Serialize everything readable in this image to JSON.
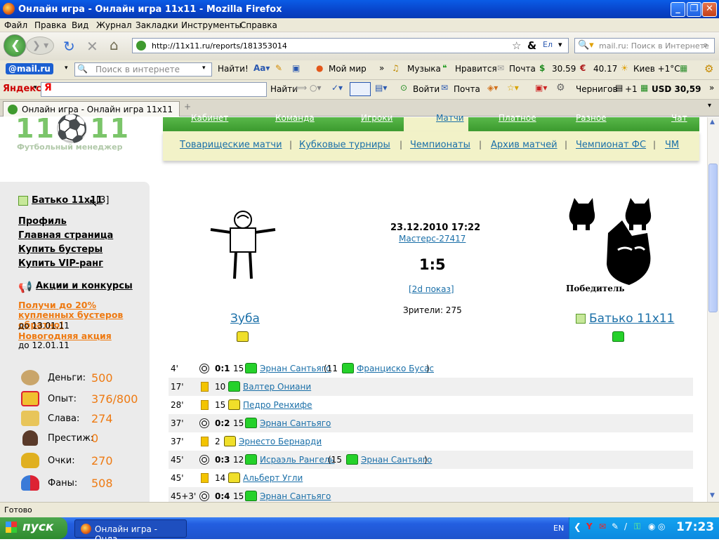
{
  "window": {
    "title": "Онлайн игра - Онлайн игра 11x11 - Mozilla Firefox"
  },
  "menu": [
    "Файл",
    "Правка",
    "Вид",
    "Журнал",
    "Закладки",
    "Инструменты",
    "Справка"
  ],
  "nav": {
    "url": "http://11x11.ru/reports/181353014",
    "search_placeholder": "mail.ru: Поиск в Интернете"
  },
  "mailru_toolbar": {
    "brand": "@mail.ru",
    "search_placeholder": "Поиск в интернете",
    "find_label": "Найти!",
    "mymir": "Мой мир",
    "music": "Музыка",
    "likes": "Нравится",
    "mail": "Почта",
    "usd": "30.59",
    "eur": "40.17",
    "weather": "Киев +1°С"
  },
  "yandex_toolbar": {
    "brand": "Яндекс",
    "find_label": "Найти",
    "login": "Войти",
    "mail": "Почта",
    "city": "Чернигов",
    "points": "+1",
    "usd": "USD 30,59"
  },
  "tab": {
    "title": "Онлайн игра - Онлайн игра 11x11",
    "new_tab": "+"
  },
  "site": {
    "logo_tagline": "Футбольный менеджер",
    "top_nav": [
      "Кабинет",
      "Команда",
      "Игроки",
      "Матчи",
      "Платное",
      "Разное",
      "Чат"
    ],
    "sub_nav": [
      "Товарищеские матчи",
      "Кубковые турниры",
      "Чемпионаты",
      "Архив матчей",
      "Чемпионат ФС",
      "ЧМ"
    ]
  },
  "sidebar": {
    "user": "Батько 11x11",
    "user_level": "[3]",
    "links": [
      "Профиль",
      "Главная страница",
      "Купить бустеры",
      "Купить VIP-ранг"
    ],
    "promo_title": "Акции и конкурсы",
    "promo1": "Получи до 20% купленных бустеров обратно!",
    "promo1_until": "до 13.01.11",
    "promo2": "Новогодняя акция",
    "promo2_until": "до 12.01.11",
    "stats": [
      {
        "label": "Деньги:",
        "value": "500"
      },
      {
        "label": "Опыт:",
        "value": "376/800"
      },
      {
        "label": "Слава:",
        "value": "274"
      },
      {
        "label": "Престиж:",
        "value": "0"
      },
      {
        "label": "Очки:",
        "value": "270"
      },
      {
        "label": "Фаны:",
        "value": "508"
      }
    ]
  },
  "match": {
    "datetime": "23.12.2010 17:22",
    "tournament": "Мастерс-27417",
    "score": "1:5",
    "show2d": "[2d показ]",
    "spectators": "Зрители: 275",
    "home_team": "Зуба",
    "away_team": "Батько 11x11",
    "winner_label": "Победитель"
  },
  "events": [
    {
      "min": "4'",
      "type": "goal",
      "score": "0:1",
      "num": "15",
      "shirt": "green",
      "player": "Эрнан Сантьяго",
      "assist_num": "(11",
      "assist": "Франциско Бусас",
      "close": ")"
    },
    {
      "min": "17'",
      "type": "card",
      "num": "10",
      "shirt": "green",
      "player": "Валтер Ониани"
    },
    {
      "min": "28'",
      "type": "card",
      "num": "15",
      "shirt": "yellow",
      "player": "Педро Ренхифе"
    },
    {
      "min": "37'",
      "type": "goal",
      "score": "0:2",
      "num": "15",
      "shirt": "green",
      "player": "Эрнан Сантьяго"
    },
    {
      "min": "37'",
      "type": "card",
      "num": "2",
      "shirt": "yellow",
      "player": "Эрнесто Бернарди"
    },
    {
      "min": "45'",
      "type": "goal",
      "score": "0:3",
      "num": "12",
      "shirt": "green",
      "player": "Исраэль Рангель",
      "assist_num": "(15",
      "assist": "Эрнан Сантьяго",
      "close": ")"
    },
    {
      "min": "45'",
      "type": "card",
      "num": "14",
      "shirt": "yellow",
      "player": "Альберт Угли"
    },
    {
      "min": "45+3'",
      "type": "goal",
      "score": "0:4",
      "num": "15",
      "shirt": "green",
      "player": "Эрнан Сантьяго"
    }
  ],
  "status": "Готово",
  "taskbar": {
    "start": "пуск",
    "item": "Онлайн игра - Онла...",
    "lang": "EN",
    "time": "17:23"
  }
}
